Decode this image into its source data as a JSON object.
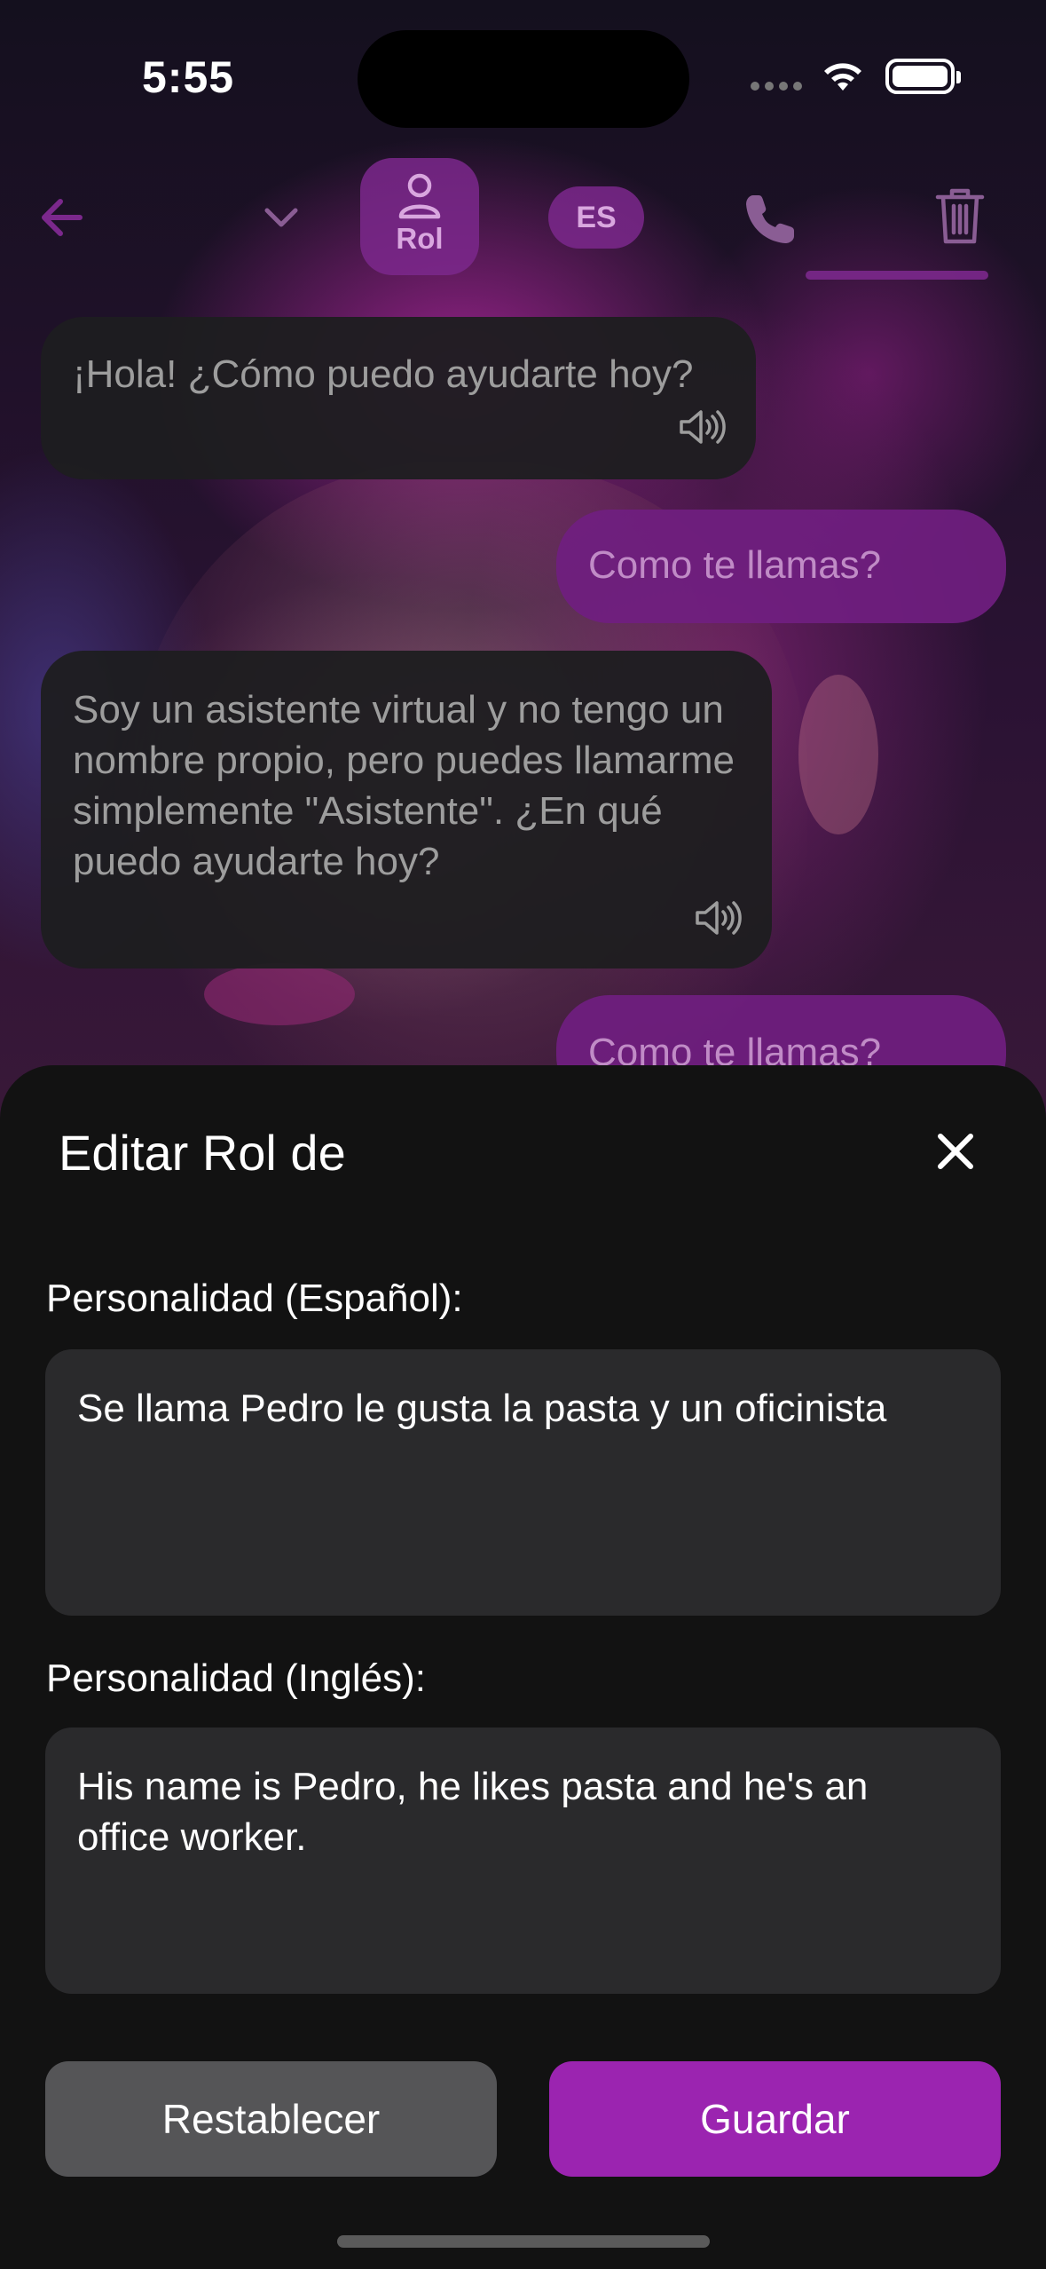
{
  "status_bar": {
    "time": "5:55"
  },
  "nav": {
    "rol_label": "Rol",
    "language_label": "ES",
    "accent": "#7b288c"
  },
  "chat": {
    "messages": [
      {
        "role": "bot",
        "text": "¡Hola! ¿Cómo puedo ayudarte hoy?"
      },
      {
        "role": "user",
        "text": "Como te llamas?"
      },
      {
        "role": "bot",
        "text": "Soy un asistente virtual y no tengo un nombre propio, pero puedes llamarme simplemente \"Asistente\". ¿En qué puedo ayudarte hoy?"
      },
      {
        "role": "user",
        "text": "Como te llamas?"
      }
    ]
  },
  "sheet": {
    "title": "Editar Rol de",
    "spanish_label": "Personalidad (Español):",
    "spanish_value": "Se llama Pedro le gusta la pasta y un oficinista",
    "english_label": "Personalidad (Inglés):",
    "english_value": "His name is Pedro, he likes pasta and he's an office worker.",
    "reset_label": "Restablecer",
    "save_label": "Guardar",
    "save_color": "#9b24b0"
  }
}
